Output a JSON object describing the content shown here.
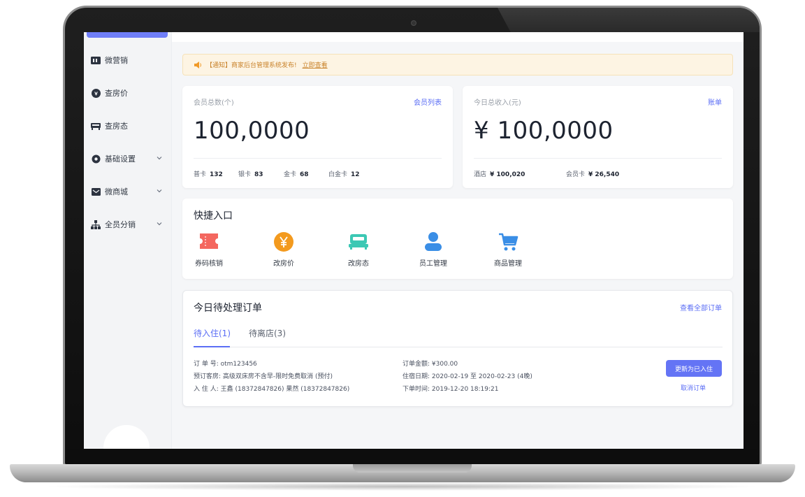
{
  "sidebar": {
    "items": [
      {
        "label": "微营销",
        "icon": "wallet-icon",
        "has_chevron": false
      },
      {
        "label": "查房价",
        "icon": "price-tag-icon",
        "has_chevron": false
      },
      {
        "label": "查房态",
        "icon": "bed-icon",
        "has_chevron": false
      },
      {
        "label": "基础设置",
        "icon": "gear-icon",
        "has_chevron": true
      },
      {
        "label": "微商城",
        "icon": "mail-icon",
        "has_chevron": true
      },
      {
        "label": "全员分销",
        "icon": "org-chart-icon",
        "has_chevron": true
      }
    ]
  },
  "notice": {
    "text": "【通知】商家后台管理系统发布!",
    "link": "立即查看"
  },
  "members_card": {
    "label": "会员总数(个)",
    "link": "会员列表",
    "value": "100,0000",
    "stats": [
      {
        "label": "普卡",
        "value": "132"
      },
      {
        "label": "银卡",
        "value": "83"
      },
      {
        "label": "金卡",
        "value": "68"
      },
      {
        "label": "白金卡",
        "value": "12"
      }
    ]
  },
  "income_card": {
    "label": "今日总收入(元)",
    "link": "账单",
    "value": "¥ 100,0000",
    "stats": [
      {
        "label": "酒店",
        "value": "¥ 100,020"
      },
      {
        "label": "会员卡",
        "value": "¥ 26,540"
      }
    ]
  },
  "quick_entry": {
    "title": "快捷入口",
    "items": [
      {
        "label": "券码核销",
        "icon": "ticket-icon",
        "color": "#f4675f"
      },
      {
        "label": "改房价",
        "icon": "yen-icon",
        "color": "#f39a1e"
      },
      {
        "label": "改房态",
        "icon": "bed-icon",
        "color": "#3cc8b4"
      },
      {
        "label": "员工管理",
        "icon": "user-icon",
        "color": "#3a8ee6"
      },
      {
        "label": "商品管理",
        "icon": "cart-icon",
        "color": "#3a8ee6"
      }
    ]
  },
  "orders": {
    "title": "今日待处理订单",
    "view_all": "查看全部订单",
    "tabs": [
      {
        "label": "待入住(1)",
        "active": true
      },
      {
        "label": "待离店(3)",
        "active": false
      }
    ],
    "order": {
      "left": [
        "订 单 号: otm123456",
        "预订客房: 高级双床房不含早-限时免费取消 (预付)",
        "入 住 人: 王鑫 (18372847826) 果然 (18372847826)"
      ],
      "right": [
        "订单金额: ¥300.00",
        "住宿日期: 2020-02-19 至 2020-02-23 (4晚)",
        "下单时间: 2019-12-20 18:19:21"
      ],
      "primary_action": "更新为已入住",
      "secondary_action": "取消订单"
    }
  },
  "colors": {
    "accent": "#5b6ef5",
    "notice_bg": "#fdf4e3",
    "notice_text": "#c9822a"
  }
}
